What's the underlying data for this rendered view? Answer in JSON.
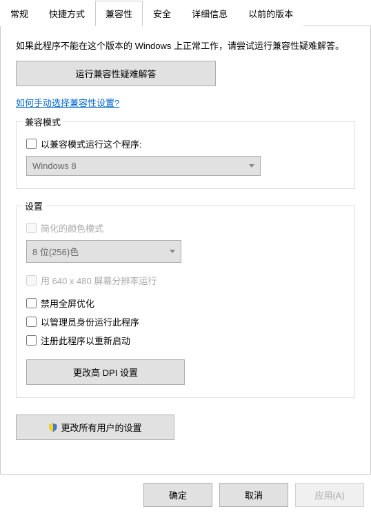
{
  "tabs": {
    "general": "常规",
    "shortcut": "快捷方式",
    "compatibility": "兼容性",
    "security": "安全",
    "details": "详细信息",
    "previous": "以前的版本"
  },
  "desc": "如果此程序不能在这个版本的 Windows 上正常工作，请尝试运行兼容性疑难解答。",
  "btn_troubleshoot": "运行兼容性疑难解答",
  "link_manual": "如何手动选择兼容性设置?",
  "group_compat_title": "兼容模式",
  "chk_compat_mode": "以兼容模式运行这个程序:",
  "compat_mode_value": "Windows 8",
  "group_settings_title": "设置",
  "chk_reduced_color": "简化的颜色模式",
  "color_value": "8 位(256)色",
  "chk_640x480": "用 640 x 480 屏幕分辨率运行",
  "chk_disable_fullscreen": "禁用全屏优化",
  "chk_run_as_admin": "以管理员身份运行此程序",
  "chk_register_restart": "注册此程序以重新启动",
  "btn_dpi": "更改高 DPI 设置",
  "btn_all_users": "更改所有用户的设置",
  "footer": {
    "ok": "确定",
    "cancel": "取消",
    "apply": "应用(A)"
  }
}
